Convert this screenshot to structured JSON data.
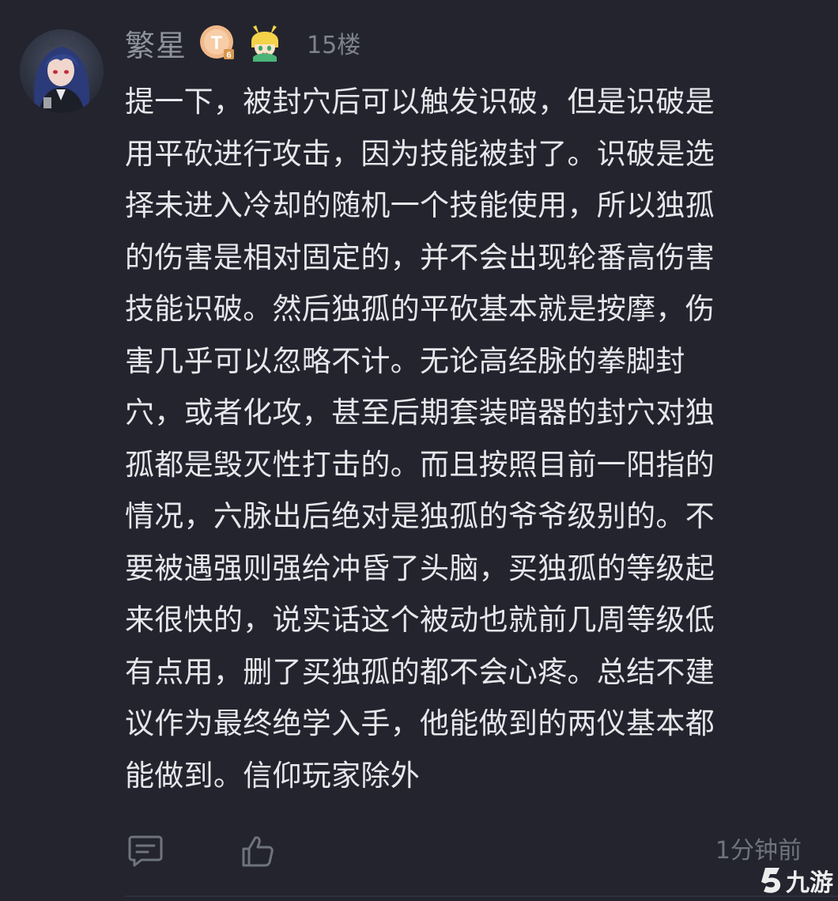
{
  "comment": {
    "username": "繁星",
    "level_badge": "T",
    "floor": "15楼",
    "time": "1分钟前",
    "body_lines": [
      "提一下，被封穴后可以触发识破，但是识破是",
      "用平砍进行攻击，因为技能被封了。识破是选",
      "择未进入冷却的随机一个技能使用，所以独孤",
      "的伤害是相对固定的，并不会出现轮番高伤害",
      "技能识破。然后独孤的平砍基本就是按摩，伤",
      "害几乎可以忽略不计。无论高经脉的拳脚封",
      "穴，或者化攻，甚至后期套装暗器的封穴对独",
      "孤都是毁灭性打击的。而且按照目前一阳指的",
      "情况，六脉出后绝对是独孤的爷爷级别的。不",
      "要被遇强则强给冲昏了头脑，买独孤的等级起",
      "来很快的，说实话这个被动也就前几周等级低",
      "有点用，删了买独孤的都不会心疼。总结不建",
      "议作为最终绝学入手，他能做到的两仪基本都",
      "能做到。信仰玩家除外"
    ]
  },
  "actions": {
    "reply_icon": "comment-icon",
    "like_icon": "thumbs-up-icon"
  },
  "watermark": {
    "text": "九游"
  },
  "colors": {
    "background": "#23242e",
    "text": "#e6e7ea",
    "muted": "#8e929c",
    "badge": "#f1b98a"
  }
}
